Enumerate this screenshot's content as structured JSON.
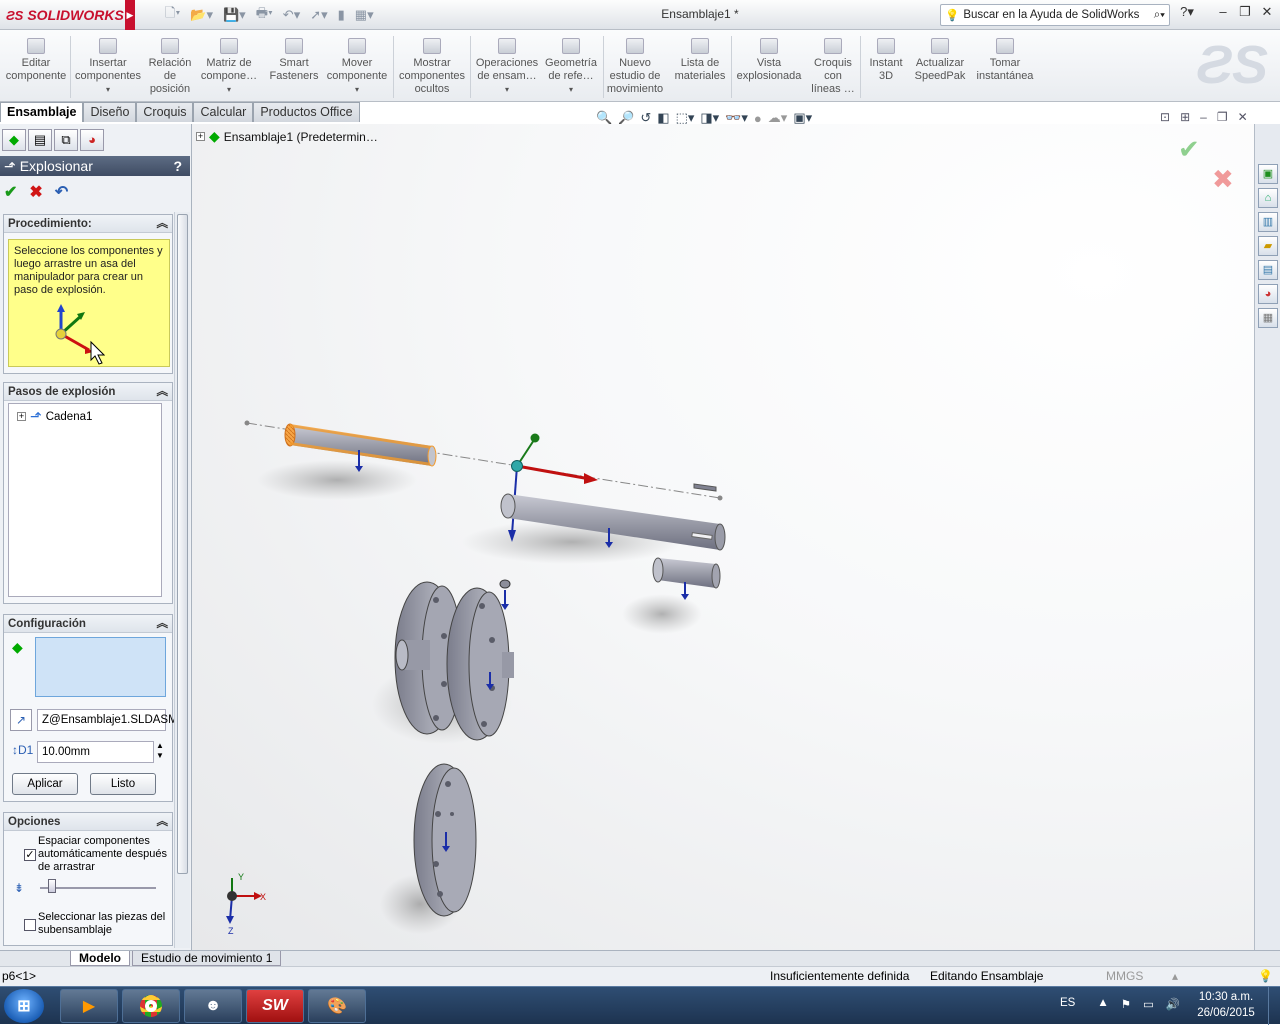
{
  "app": {
    "logo_text": "SOLIDWORKS",
    "doc_title": "Ensamblaje1 *",
    "help_placeholder": "Buscar en la Ayuda de SolidWorks"
  },
  "ribbon": {
    "buttons": [
      {
        "label": "Editar\ncomponente"
      },
      {
        "label": "Insertar\ncomponentes"
      },
      {
        "label": "Relación\nde\nposición"
      },
      {
        "label": "Matriz de\ncompone…"
      },
      {
        "label": "Smart\nFasteners"
      },
      {
        "label": "Mover\ncomponente"
      },
      {
        "label": "Mostrar\ncomponentes\nocultos"
      },
      {
        "label": "Operaciones\nde ensam…"
      },
      {
        "label": "Geometría\nde refe…"
      },
      {
        "label": "Nuevo\nestudio de\nmovimiento"
      },
      {
        "label": "Lista de\nmateriales"
      },
      {
        "label": "Vista\nexplosionada"
      },
      {
        "label": "Croquis\ncon\nlíneas …"
      },
      {
        "label": "Instant\n3D"
      },
      {
        "label": "Actualizar\nSpeedPak"
      },
      {
        "label": "Tomar\ninstantánea"
      }
    ]
  },
  "command_tabs": [
    "Ensamblaje",
    "Diseño",
    "Croquis",
    "Calcular",
    "Productos Office"
  ],
  "property_manager": {
    "title": "Explosionar",
    "help": "?",
    "procedure": {
      "header": "Procedimiento:",
      "text": "Seleccione los componentes y luego arrastre un asa del manipulador para crear un paso de explosión."
    },
    "steps": {
      "header": "Pasos de explosión",
      "item": "Cadena1"
    },
    "config": {
      "header": "Configuración",
      "direction": "Z@Ensamblaje1.SLDASM",
      "distance": "10.00mm",
      "apply": "Aplicar",
      "done": "Listo"
    },
    "options": {
      "header": "Opciones",
      "auto_space": "Espaciar componentes automáticamente después de arrastrar",
      "select_sub": "Seleccionar las piezas del subensamblaje"
    }
  },
  "graphics": {
    "tree_root": "Ensamblaje1  (Predetermin…",
    "triad": {
      "x": "X",
      "y": "Y",
      "z": "Z"
    }
  },
  "bottom_tabs": [
    "Modelo",
    "Estudio de movimiento 1"
  ],
  "status": {
    "left": "p6<1>",
    "definition": "Insuficientemente definida",
    "mode": "Editando Ensamblaje",
    "units": "MMGS"
  },
  "taskbar": {
    "lang": "ES",
    "time": "10:30 a.m.",
    "date": "26/06/2015"
  },
  "colors": {
    "accent_red": "#c8102e",
    "proc_yellow": "#ffff8a",
    "part_gray": "#9a9ca8",
    "selected_orange": "#f39a2b"
  }
}
